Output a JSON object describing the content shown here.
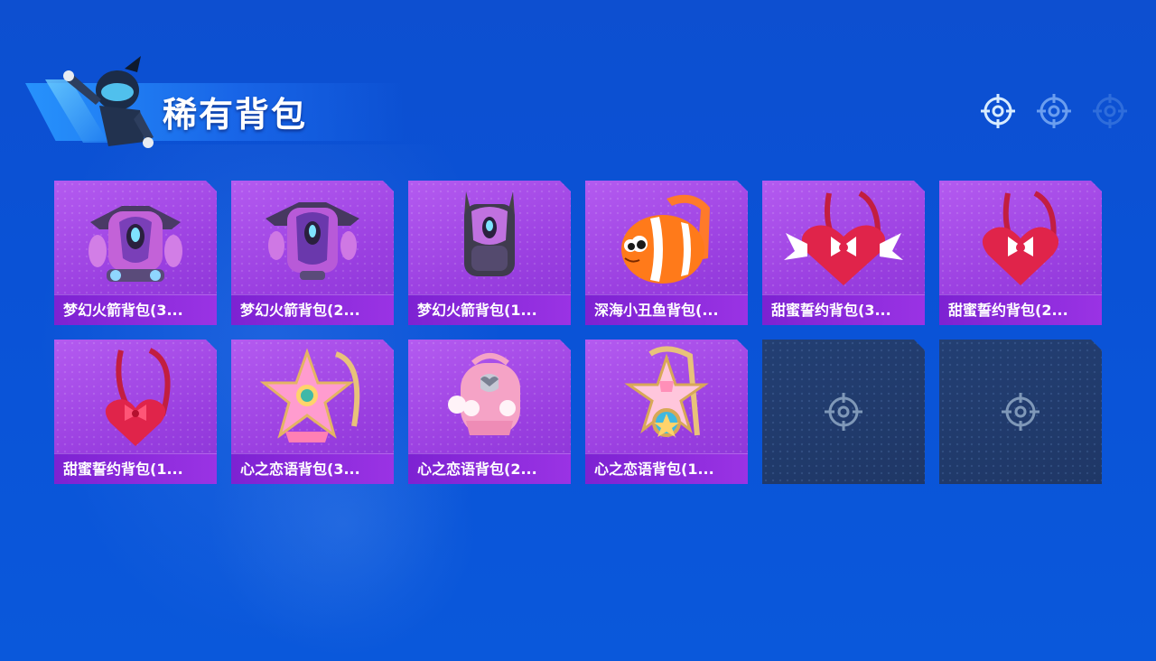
{
  "header": {
    "title": "稀有背包"
  },
  "indicators": [
    {
      "icon": "crosshair-icon",
      "state": "active"
    },
    {
      "icon": "crosshair-icon",
      "state": "inactive"
    },
    {
      "icon": "crosshair-icon",
      "state": "dim"
    }
  ],
  "items": [
    {
      "label": "梦幻火箭背包(3...",
      "icon": "rocket-backpack-icon",
      "color": "#d06ee0"
    },
    {
      "label": "梦幻火箭背包(2...",
      "icon": "rocket-backpack-icon",
      "color": "#b85ad8"
    },
    {
      "label": "梦幻火箭背包(1...",
      "icon": "rocket-backpack-icon",
      "color": "#c071e0"
    },
    {
      "label": "深海小丑鱼背包(...",
      "icon": "clownfish-backpack-icon",
      "color": "#ff7a1a"
    },
    {
      "label": "甜蜜誓约背包(3...",
      "icon": "heart-backpack-icon",
      "color": "#e0244a"
    },
    {
      "label": "甜蜜誓约背包(2...",
      "icon": "heart-backpack-icon",
      "color": "#e0244a"
    },
    {
      "label": "甜蜜誓约背包(1...",
      "icon": "heart-backpack-icon",
      "color": "#e0244a"
    },
    {
      "label": "心之恋语背包(3...",
      "icon": "star-backpack-icon",
      "color": "#ff9ccf"
    },
    {
      "label": "心之恋语背包(2...",
      "icon": "pink-backpack-icon",
      "color": "#f5a3c6"
    },
    {
      "label": "心之恋语背包(1...",
      "icon": "star-backpack-icon",
      "color": "#ffc6dc"
    }
  ],
  "empty_slots": 2,
  "colors": {
    "card": "#9a3fe0",
    "label_bar": "#7d22d2",
    "empty_slot": "#233f73",
    "background": "#0a52d6"
  }
}
